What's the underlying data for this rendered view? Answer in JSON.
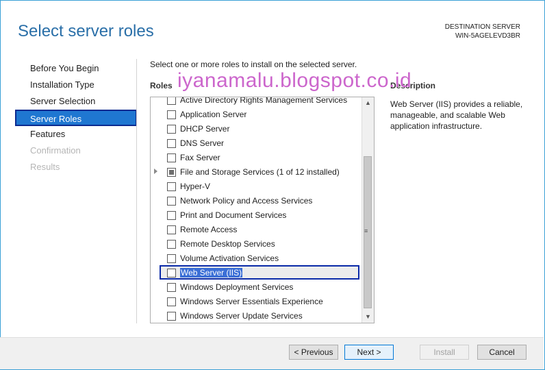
{
  "window": {
    "title": "Select server roles",
    "destination_label": "DESTINATION SERVER",
    "destination_server": "WIN-5AGELEVD3BR"
  },
  "nav": {
    "items": [
      {
        "label": "Before You Begin"
      },
      {
        "label": "Installation Type"
      },
      {
        "label": "Server Selection"
      },
      {
        "label": "Server Roles"
      },
      {
        "label": "Features"
      },
      {
        "label": "Confirmation"
      },
      {
        "label": "Results"
      }
    ]
  },
  "main": {
    "intro": "Select one or more roles to install on the selected server.",
    "watermark": "iyanamalu.blogspot.co.id",
    "roles_header": "Roles",
    "description_header": "Description",
    "description": "Web Server (IIS) provides a reliable, manageable, and scalable Web application infrastructure.",
    "roles": [
      {
        "label": "Active Directory Rights Management Services",
        "checked": false
      },
      {
        "label": "Application Server",
        "checked": false
      },
      {
        "label": "DHCP Server",
        "checked": false
      },
      {
        "label": "DNS Server",
        "checked": false
      },
      {
        "label": "Fax Server",
        "checked": false
      },
      {
        "label": "File and Storage Services (1 of 12 installed)",
        "checked": "partial",
        "expandable": true
      },
      {
        "label": "Hyper-V",
        "checked": false
      },
      {
        "label": "Network Policy and Access Services",
        "checked": false
      },
      {
        "label": "Print and Document Services",
        "checked": false
      },
      {
        "label": "Remote Access",
        "checked": false
      },
      {
        "label": "Remote Desktop Services",
        "checked": false
      },
      {
        "label": "Volume Activation Services",
        "checked": false
      },
      {
        "label": "Web Server (IIS)",
        "checked": false,
        "selected": true
      },
      {
        "label": "Windows Deployment Services",
        "checked": false
      },
      {
        "label": "Windows Server Essentials Experience",
        "checked": false
      },
      {
        "label": "Windows Server Update Services",
        "checked": false
      }
    ]
  },
  "footer": {
    "previous": "< Previous",
    "next": "Next >",
    "install": "Install",
    "cancel": "Cancel"
  }
}
